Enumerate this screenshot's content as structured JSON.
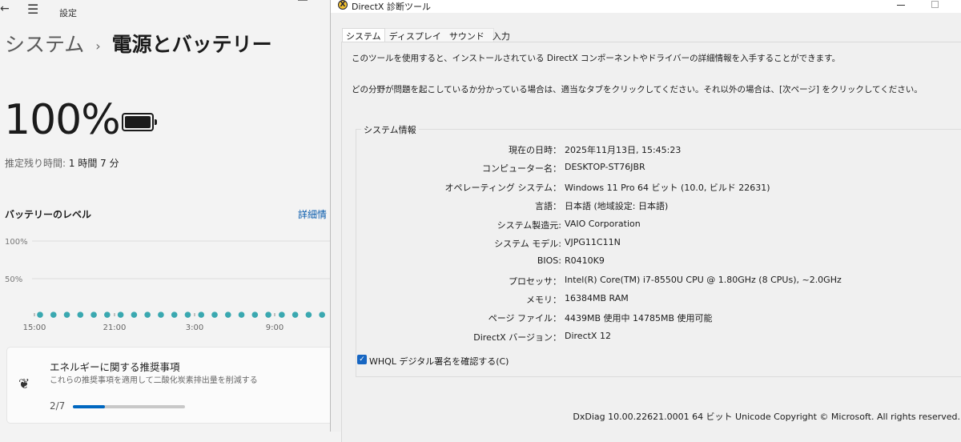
{
  "settings": {
    "app_title": "設定",
    "breadcrumb_parent": "システム",
    "breadcrumb_separator": "›",
    "page_title": "電源とバッテリー",
    "battery_percent": "100%",
    "battery_fill_level": 100,
    "remaining_label": "推定残り時間:",
    "remaining_value": "1 時間 7 分",
    "level_heading": "バッテリーのレベル",
    "detail_link": "詳細情",
    "recommend": {
      "title": "エネルギーに関する推奨事項",
      "subtitle": "これらの推奨事項を適用して二酸化炭素排出量を削減する",
      "progress_text": "2/7",
      "progress_fraction": 0.2857
    },
    "accent_color": "#0067c0",
    "icons": [
      "back-arrow-icon",
      "hamburger-menu-icon",
      "battery-icon",
      "leaf-icon",
      "minimize-icon"
    ]
  },
  "chart_data": {
    "type": "scatter",
    "y_tick_labels": [
      "100%",
      "50%"
    ],
    "x_tick_labels": [
      "15:00",
      "21:00",
      "3:00",
      "9:00"
    ],
    "ylim": [
      0,
      100
    ],
    "grid": true,
    "point_color": "#3aa8b0",
    "x": [
      "15:30",
      "16:30",
      "17:30",
      "18:30",
      "19:30",
      "20:30",
      "21:30",
      "22:30",
      "23:30",
      "0:30",
      "1:30",
      "2:30",
      "3:30",
      "4:30",
      "5:30",
      "6:30",
      "7:30",
      "8:30",
      "9:30",
      "10:30",
      "11:30",
      "12:30"
    ],
    "values": [
      2,
      2,
      2,
      2,
      2,
      2,
      2,
      2,
      2,
      2,
      2,
      2,
      2,
      2,
      2,
      2,
      2,
      2,
      2,
      2,
      2,
      2
    ]
  },
  "dxdiag": {
    "window_title": "DirectX 診断ツール",
    "tabs": [
      {
        "label": "システム",
        "active": true
      },
      {
        "label": "ディスプレイ"
      },
      {
        "label": "サウンド"
      },
      {
        "label": "入力"
      }
    ],
    "intro1": "このツールを使用すると、インストールされている DirectX コンポーネントやドライバーの詳細情報を入手することができます。",
    "intro2": "どの分野が問題を起こしているか分かっている場合は、適当なタブをクリックしてください。それ以外の場合は、[次ページ] をクリックしてください。",
    "section_title": "システム情報",
    "rows": [
      {
        "k": "現在の日時：",
        "v": "2025年11月13日, 15:45:23"
      },
      {
        "k": "コンピューター名：",
        "v": "DESKTOP-ST76JBR"
      },
      {
        "k": "オペレーティング システム：",
        "v": "Windows 11 Pro 64 ビット (10.0, ビルド 22631)"
      },
      {
        "k": "言語：",
        "v": "日本語 (地域設定: 日本語)"
      },
      {
        "k": "システム製造元:",
        "v": "VAIO Corporation"
      },
      {
        "k": "システム モデル:",
        "v": "VJPG11C11N"
      },
      {
        "k": "BIOS:",
        "v": "R0410K9"
      },
      {
        "k": "プロセッサ：",
        "v": "Intel(R) Core(TM) i7-8550U CPU @ 1.80GHz (8 CPUs), ~2.0GHz"
      },
      {
        "k": "メモリ：",
        "v": "16384MB RAM"
      },
      {
        "k": "ページ ファイル：",
        "v": "4439MB 使用中 14785MB 使用可能"
      },
      {
        "k": "DirectX バージョン：",
        "v": "DirectX 12"
      }
    ],
    "whql_label": "WHQL デジタル署名を確認する(C)",
    "whql_checked": true,
    "footer": "DxDiag 10.00.22621.0001 64 ビット Unicode  Copyright © Microsoft. All rights reserved.",
    "icons": [
      "directx-logo-icon",
      "minimize-icon",
      "maximize-icon",
      "checkbox-checked-icon"
    ]
  }
}
